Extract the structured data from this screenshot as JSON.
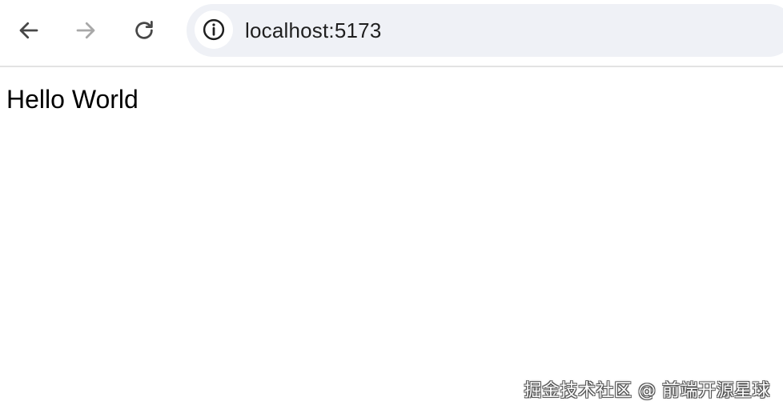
{
  "browser": {
    "back_icon": "arrow-left-icon",
    "forward_icon": "arrow-right-icon",
    "reload_icon": "reload-icon",
    "site_info_icon": "info-icon",
    "url": "localhost:5173",
    "colors": {
      "icon_active": "#474747",
      "icon_disabled": "#a8a8a8",
      "omnibox_bg": "#eff1f6"
    }
  },
  "page": {
    "heading": "Hello World"
  },
  "watermark": {
    "text": "掘金技术社区 @ 前端开源星球"
  }
}
